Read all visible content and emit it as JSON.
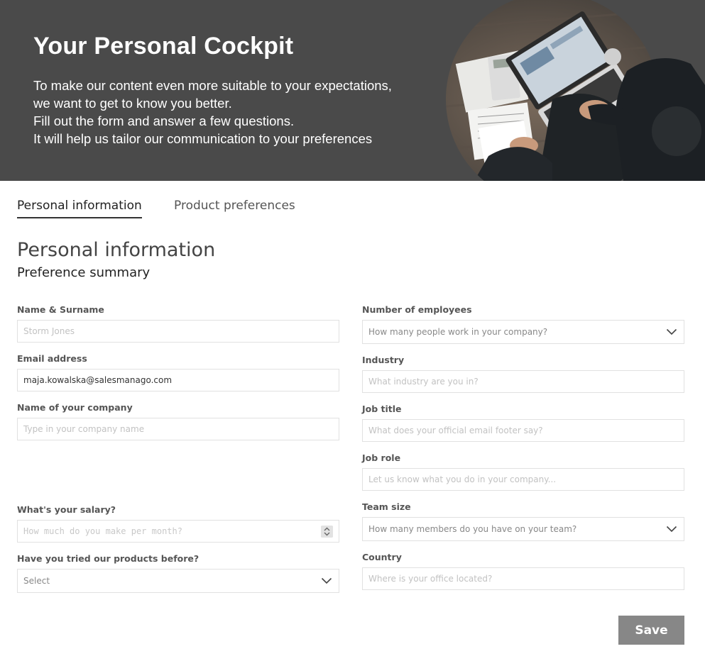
{
  "hero": {
    "title": "Your Personal Cockpit",
    "lines": [
      "To make our content even more suitable to your expectations,",
      "we want to get to know you better.",
      "Fill out the form and answer a few questions.",
      "It will help us tailor our communication to your preferences"
    ]
  },
  "tabs": {
    "personal": "Personal information",
    "product": "Product preferences"
  },
  "section": {
    "title": "Personal information",
    "subtitle": "Preference summary"
  },
  "left": {
    "name": {
      "label": "Name & Surname",
      "placeholder": "Storm Jones"
    },
    "email": {
      "label": "Email address",
      "value": "maja.kowalska@salesmanago.com"
    },
    "company": {
      "label": "Name of your company",
      "placeholder": "Type in your company name"
    },
    "salary": {
      "label": "What's your salary?",
      "placeholder": "How much do you make per month?"
    },
    "tried": {
      "label": "Have you tried our products before?",
      "value": "Select"
    }
  },
  "right": {
    "employees": {
      "label": "Number of employees",
      "value": "How many people work in your company?"
    },
    "industry": {
      "label": "Industry",
      "placeholder": "What industry are you in?"
    },
    "job_title": {
      "label": "Job title",
      "placeholder": "What does your official email footer say?"
    },
    "job_role": {
      "label": "Job role",
      "placeholder": "Let us know what you do in your company..."
    },
    "team_size": {
      "label": "Team size",
      "value": "How many members do you have on your team?"
    },
    "country": {
      "label": "Country",
      "placeholder": "Where is your office located?"
    }
  },
  "save_label": "Save",
  "icons": {
    "dropdown": "chevron-down-icon",
    "spinner": "spinner-arrows-icon"
  },
  "colors": {
    "hero_bg": "#4a4a4a",
    "save_bg": "#878787",
    "field_border": "#e1e1e1"
  }
}
